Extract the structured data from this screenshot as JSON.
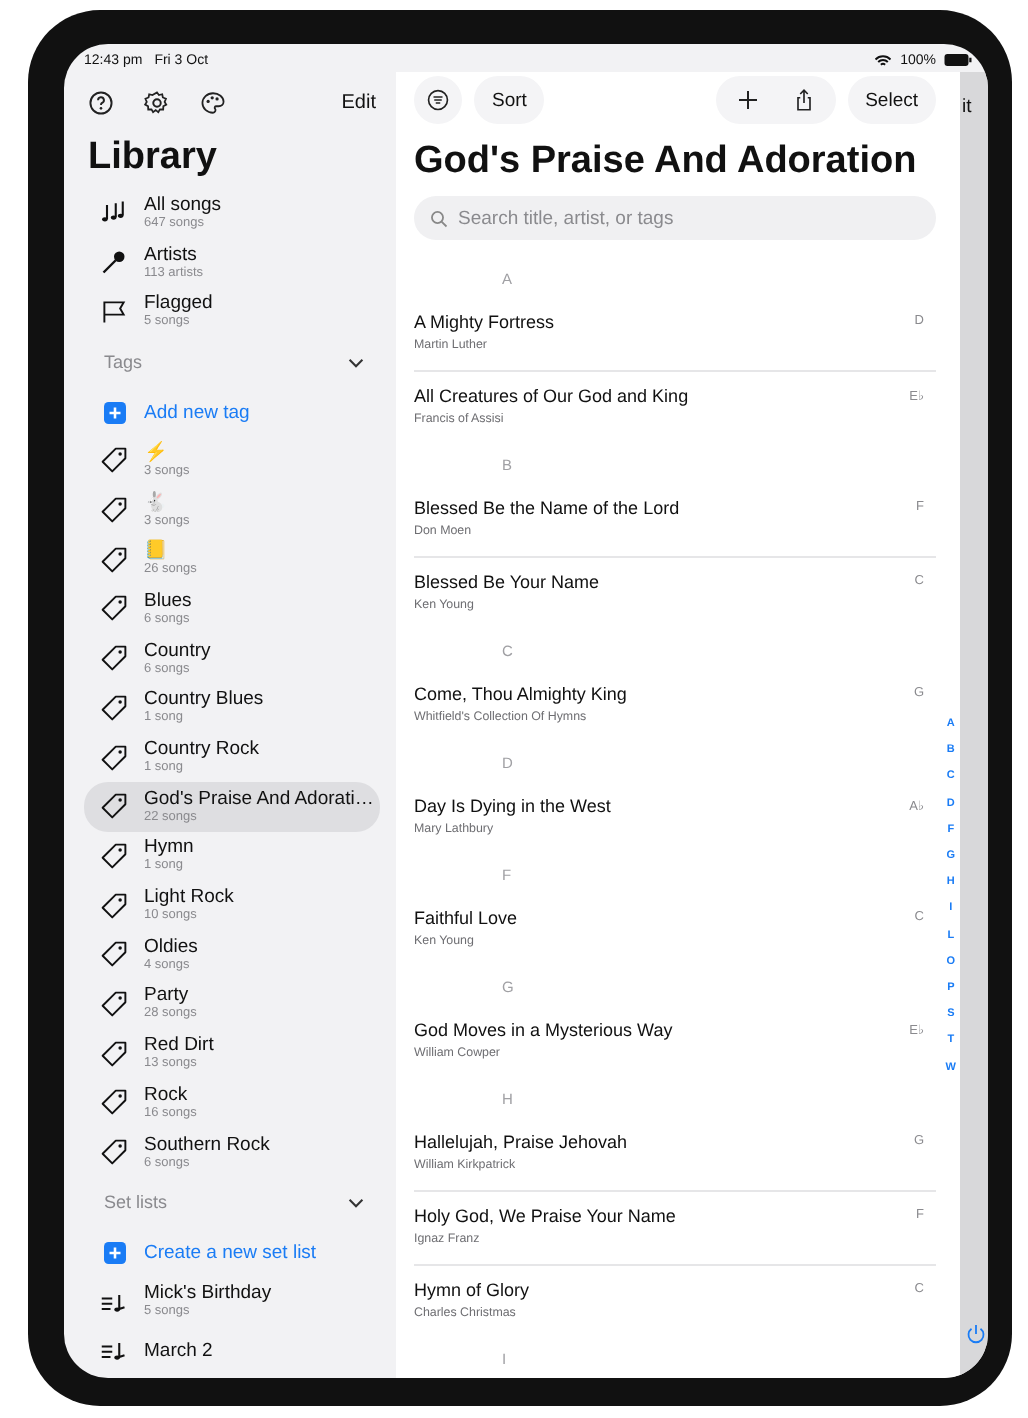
{
  "status_bar": {
    "time": "12:43 pm",
    "date": "Fri 3 Oct",
    "battery": "100%"
  },
  "sidebar": {
    "edit": "Edit",
    "title": "Library",
    "library": [
      {
        "kind": "notes",
        "title": "All songs",
        "subtitle": "647 songs"
      },
      {
        "kind": "mic",
        "title": "Artists",
        "subtitle": "113 artists"
      },
      {
        "kind": "flag",
        "title": "Flagged",
        "subtitle": "5 songs"
      }
    ],
    "tags": {
      "heading": "Tags",
      "expanded": true,
      "add": "Add new tag",
      "items": [
        {
          "label": "⚡",
          "count": "3 songs",
          "selected": false
        },
        {
          "label": "🐇",
          "count": "3 songs",
          "selected": false
        },
        {
          "label": "📒",
          "count": "26 songs",
          "selected": false
        },
        {
          "label": "Blues",
          "count": "6 songs",
          "selected": false
        },
        {
          "label": "Country",
          "count": "6 songs",
          "selected": false
        },
        {
          "label": "Country Blues",
          "count": "1 song",
          "selected": false
        },
        {
          "label": "Country Rock",
          "count": "1 song",
          "selected": false
        },
        {
          "label": "God's Praise And Adorati…",
          "count": "22 songs",
          "selected": true
        },
        {
          "label": "Hymn",
          "count": "1 song",
          "selected": false
        },
        {
          "label": "Light Rock",
          "count": "10 songs",
          "selected": false
        },
        {
          "label": "Oldies",
          "count": "4 songs",
          "selected": false
        },
        {
          "label": "Party",
          "count": "28 songs",
          "selected": false
        },
        {
          "label": "Red Dirt",
          "count": "13 songs",
          "selected": false
        },
        {
          "label": "Rock",
          "count": "16 songs",
          "selected": false
        },
        {
          "label": "Southern Rock",
          "count": "6 songs",
          "selected": false
        }
      ]
    },
    "set_lists": {
      "heading": "Set lists",
      "expanded": true,
      "add": "Create a new set list",
      "items": [
        {
          "title": "Mick's Birthday",
          "subtitle": "5 songs"
        },
        {
          "title": "March 2"
        }
      ]
    }
  },
  "main": {
    "sort": "Sort",
    "select": "Select",
    "edge_button": "it",
    "title": "God's Praise And Adoration",
    "search": {
      "placeholder": "Search title, artist, or tags"
    },
    "sections": [
      {
        "letter": "A",
        "songs": [
          {
            "title": "A Mighty Fortress",
            "artist": "Martin Luther",
            "key": "D"
          },
          {
            "title": "All Creatures of Our God and King",
            "artist": "Francis of Assisi",
            "key": "E♭"
          }
        ]
      },
      {
        "letter": "B",
        "songs": [
          {
            "title": "Blessed Be the Name of the Lord",
            "artist": "Don Moen",
            "key": "F"
          },
          {
            "title": "Blessed Be Your Name",
            "artist": "Ken Young",
            "key": "C"
          }
        ]
      },
      {
        "letter": "C",
        "songs": [
          {
            "title": "Come, Thou Almighty King",
            "artist": "Whitfield's Collection Of Hymns",
            "key": "G"
          }
        ]
      },
      {
        "letter": "D",
        "songs": [
          {
            "title": "Day Is Dying in the West",
            "artist": "Mary Lathbury",
            "key": "A♭"
          }
        ]
      },
      {
        "letter": "F",
        "songs": [
          {
            "title": "Faithful Love",
            "artist": "Ken Young",
            "key": "C"
          }
        ]
      },
      {
        "letter": "G",
        "songs": [
          {
            "title": "God Moves in a Mysterious Way",
            "artist": "William Cowper",
            "key": "E♭"
          }
        ]
      },
      {
        "letter": "H",
        "songs": [
          {
            "title": "Hallelujah, Praise Jehovah",
            "artist": "William Kirkpatrick",
            "key": "G"
          },
          {
            "title": "Holy God, We Praise Your Name",
            "artist": "Ignaz Franz",
            "key": "F"
          },
          {
            "title": "Hymn of Glory",
            "artist": "Charles Christmas",
            "key": "C"
          }
        ]
      },
      {
        "letter": "I"
      }
    ],
    "index": [
      "A",
      "B",
      "C",
      "D",
      "F",
      "G",
      "H",
      "I",
      "L",
      "O",
      "P",
      "S",
      "T",
      "W"
    ]
  }
}
